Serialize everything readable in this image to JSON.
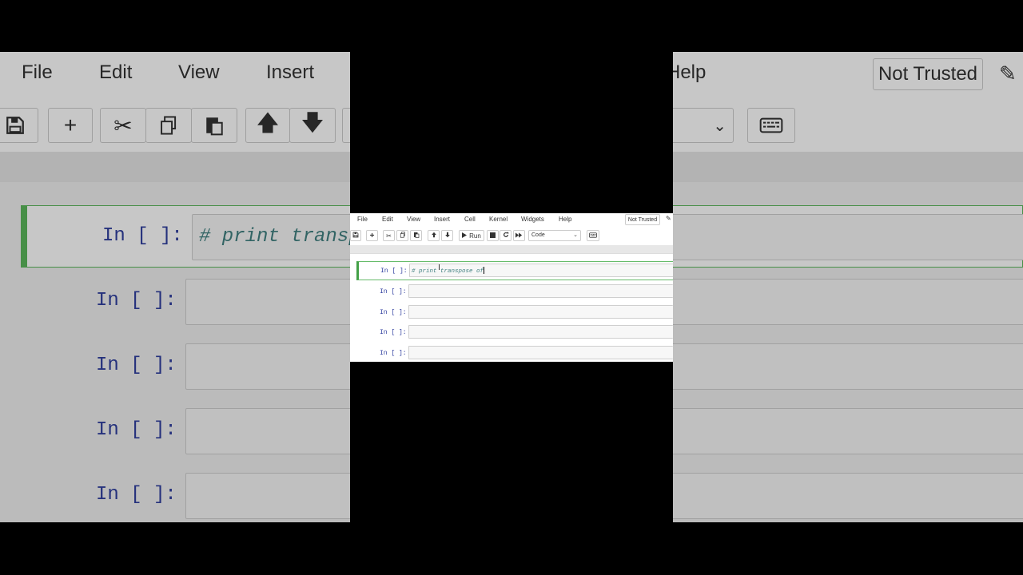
{
  "menubar": {
    "items": [
      "File",
      "Edit",
      "View",
      "Insert",
      "Cell",
      "Kernel",
      "Widgets",
      "Help"
    ],
    "trusted_label": "Not Trusted",
    "edit_icon": "pencil-icon"
  },
  "toolbar": {
    "buttons": [
      "save-icon",
      "plus-icon",
      "scissors-icon",
      "copy-icon",
      "paste-icon",
      "arrow-up-icon",
      "arrow-down-icon"
    ],
    "run_label": "Run",
    "stop_icon": "stop-icon",
    "restart_icon": "restart-icon",
    "fast_forward_icon": "fast-forward-icon",
    "cell_type": "Code",
    "keyboard_icon": "keyboard-icon"
  },
  "cells": [
    {
      "prompt": "In [ ]:",
      "code": "# print transpose of",
      "selected": true
    },
    {
      "prompt": "In [ ]:",
      "code": ""
    },
    {
      "prompt": "In [ ]:",
      "code": ""
    },
    {
      "prompt": "In [ ]:",
      "code": ""
    },
    {
      "prompt": "In [ ]:",
      "code": ""
    }
  ],
  "background": {
    "menu_items": [
      "File",
      "Edit",
      "View",
      "Insert",
      "Help"
    ],
    "trusted_label": "Not Trusted",
    "first_cell_code": "# print transp",
    "prompts": [
      "In [ ]:",
      "In [ ]:",
      "In [ ]:",
      "In [ ]:",
      "In [ ]:"
    ]
  },
  "colors": {
    "prompt": "#303f9f",
    "comment": "#408080",
    "selected_border": "#43a047"
  }
}
